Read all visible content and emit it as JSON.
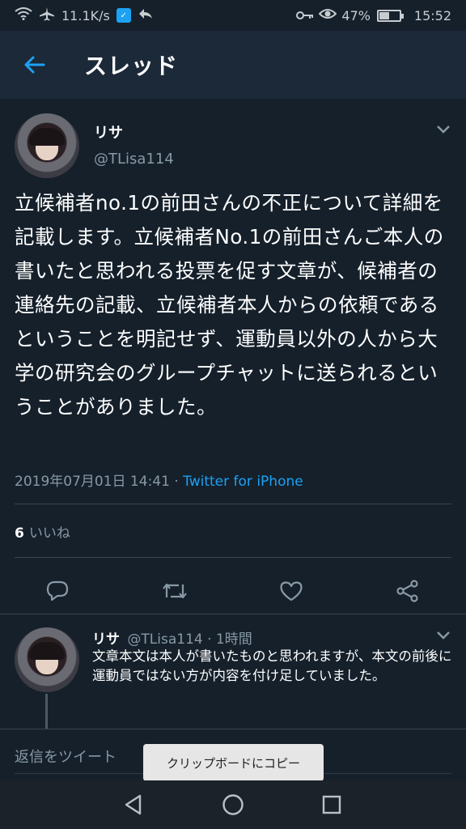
{
  "status_bar": {
    "speed": "11.1K/s",
    "battery_percent": "47%",
    "battery_level": 0.47,
    "time": "15:52"
  },
  "header": {
    "title": "スレッド",
    "back_icon": "arrow-left-icon"
  },
  "tweet": {
    "author_name": "リサ",
    "author_handle": "@TLisa114",
    "text": "立候補者no.1の前田さんの不正について詳細を記載します。立候補者No.1の前田さんご本人の書いたと思われる投票を促す文章が、候補者の連絡先の記載、立候補者本人からの依頼であるということを明記せず、運動員以外の人から大学の研究会のグループチャットに送られるということがありました。",
    "timestamp": "2019年07月01日 14:41",
    "separator": " · ",
    "source": "Twitter for iPhone",
    "likes_count": "6",
    "likes_label": "いいね"
  },
  "actions": {
    "reply_icon": "reply-icon",
    "retweet_icon": "retweet-icon",
    "like_icon": "heart-icon",
    "share_icon": "share-icon"
  },
  "reply": {
    "author_name": "リサ",
    "author_handle": "@TLisa114",
    "time_ago": "· 1時間",
    "text": "文章本文は本人が書いたものと思われますが、本文の前後に運動員ではない方が内容を付け足していました。"
  },
  "composer": {
    "placeholder": "返信をツイート"
  },
  "toast": {
    "message": "クリップボードにコピー"
  },
  "colors": {
    "background": "#15202b",
    "header": "#1c2938",
    "accent": "#1da1f2",
    "secondary_text": "#8899a6"
  }
}
